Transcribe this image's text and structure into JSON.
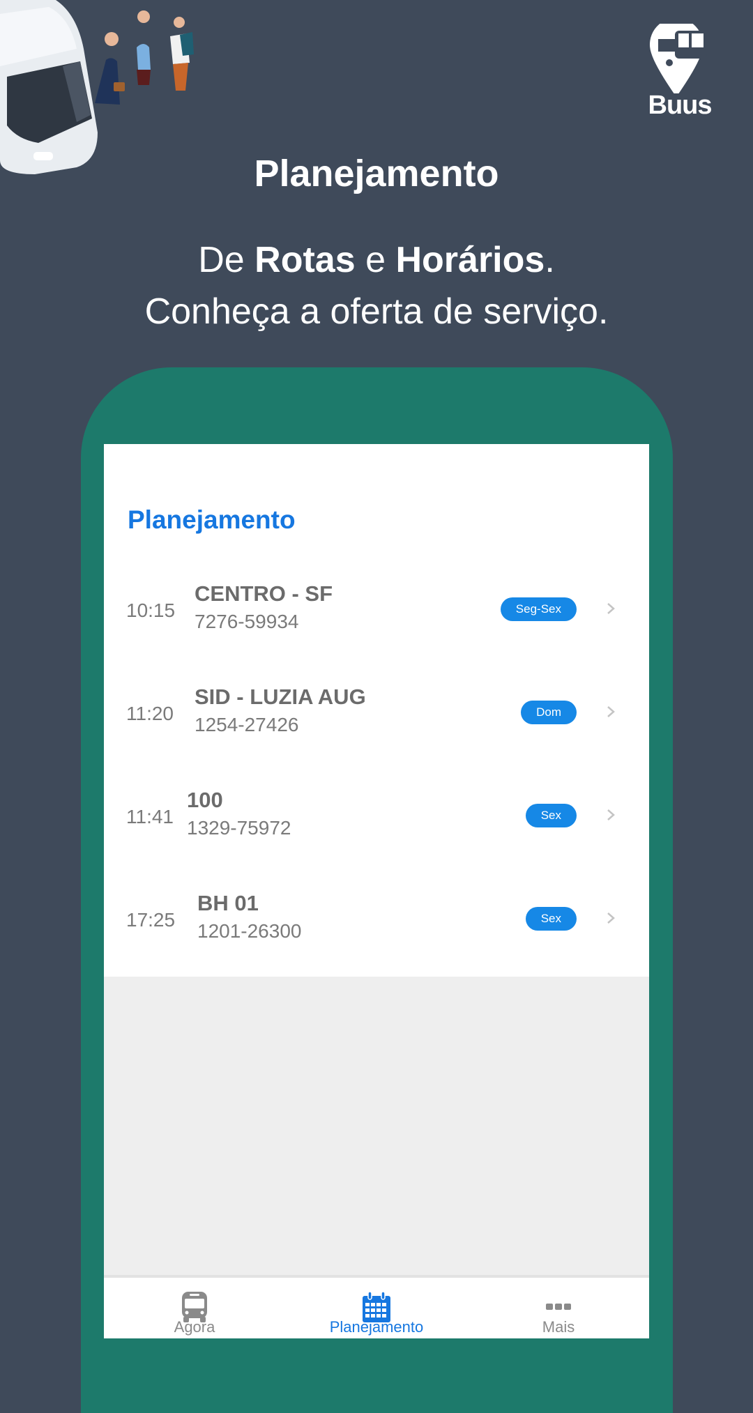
{
  "brand": {
    "name": "Buus",
    "logo_icon": "map-pin-bus-icon"
  },
  "hero": {
    "title": "Planejamento",
    "subtitle_line1_parts": [
      "De ",
      "Rotas",
      " e ",
      "Horários",
      "."
    ],
    "subtitle_line2": "Conheça a oferta de serviço."
  },
  "illustration": {
    "description": "bus-with-passengers-illustration"
  },
  "screen": {
    "title": "Planejamento",
    "trips": [
      {
        "time": "10:15",
        "name": "CENTRO - SF",
        "code": "7276-59934",
        "days": "Seg-Sex"
      },
      {
        "time": "11:20",
        "name": "SID - LUZIA AUG",
        "code": "1254-27426",
        "days": "Dom"
      },
      {
        "time": "11:41",
        "name": "100",
        "code": "1329-75972",
        "days": "Sex"
      },
      {
        "time": "17:25",
        "name": "BH 01",
        "code": "1201-26300",
        "days": "Sex"
      }
    ]
  },
  "tabbar": {
    "tabs": [
      {
        "label": "Agora",
        "icon": "bus-icon",
        "active": false
      },
      {
        "label": "Planejamento",
        "icon": "calendar-icon",
        "active": true
      },
      {
        "label": "Mais",
        "icon": "more-dots-icon",
        "active": false
      }
    ]
  },
  "colors": {
    "background": "#3f4a5a",
    "phone_frame": "#1d7a6b",
    "accent": "#1677e0",
    "badge": "#1688e6"
  }
}
